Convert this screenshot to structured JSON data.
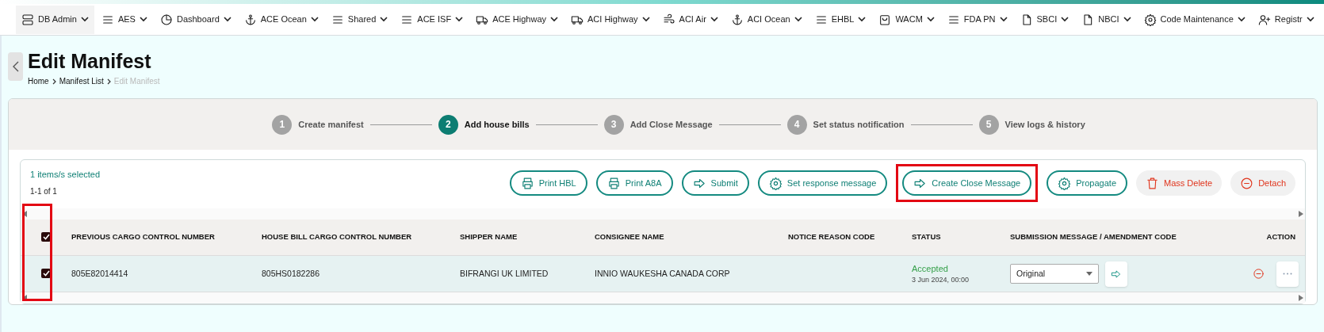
{
  "nav": [
    {
      "label": "DB Admin",
      "kind": "server",
      "selected": true
    },
    {
      "label": "AES",
      "kind": "menu",
      "selected": false
    },
    {
      "label": "Dashboard",
      "kind": "pie",
      "selected": false
    },
    {
      "label": "ACE Ocean",
      "kind": "anchor",
      "selected": false
    },
    {
      "label": "Shared",
      "kind": "menu",
      "selected": false
    },
    {
      "label": "ACE ISF",
      "kind": "menu",
      "selected": false
    },
    {
      "label": "ACE Highway",
      "kind": "truck",
      "selected": false
    },
    {
      "label": "ACI Highway",
      "kind": "truck",
      "selected": false
    },
    {
      "label": "ACI Air",
      "kind": "wind",
      "selected": false
    },
    {
      "label": "ACI Ocean",
      "kind": "anchor",
      "selected": false
    },
    {
      "label": "EHBL",
      "kind": "menu",
      "selected": false
    },
    {
      "label": "WACM",
      "kind": "bag",
      "selected": false
    },
    {
      "label": "FDA PN",
      "kind": "menu",
      "selected": false
    },
    {
      "label": "SBCI",
      "kind": "file",
      "selected": false
    },
    {
      "label": "NBCI",
      "kind": "file",
      "selected": false
    },
    {
      "label": "Code Maintenance",
      "kind": "gear",
      "selected": false
    },
    {
      "label": "Registr",
      "kind": "user",
      "selected": false
    }
  ],
  "page": {
    "title": "Edit Manifest",
    "breadcrumbs": [
      {
        "label": "Home",
        "current": false
      },
      {
        "label": "Manifest List",
        "current": false
      },
      {
        "label": "Edit Manifest",
        "current": true
      }
    ]
  },
  "steps": [
    {
      "number": "1",
      "label": "Create manifest",
      "selected": false
    },
    {
      "number": "2",
      "label": "Add house bills",
      "selected": true
    },
    {
      "number": "3",
      "label": "Add Close Message",
      "selected": false
    },
    {
      "number": "4",
      "label": "Set status notification",
      "selected": false
    },
    {
      "number": "5",
      "label": "View logs & history",
      "selected": false
    }
  ],
  "selection_summary": "1 items/s selected",
  "range": "1-1 of 1",
  "toolbar": [
    {
      "label": "Print HBL",
      "kind": "printer",
      "danger": false,
      "highlighted": false
    },
    {
      "label": "Print A8A",
      "kind": "printer",
      "danger": false,
      "highlighted": false
    },
    {
      "label": "Submit",
      "kind": "arrow",
      "danger": false,
      "highlighted": false
    },
    {
      "label": "Set response message",
      "kind": "gear",
      "danger": false,
      "highlighted": false
    },
    {
      "label": "Create Close Message",
      "kind": "arrow",
      "danger": false,
      "highlighted": true
    },
    {
      "label": "Propagate",
      "kind": "gear",
      "danger": false,
      "highlighted": false
    },
    {
      "label": "Mass Delete",
      "kind": "trash",
      "danger": true,
      "highlighted": false
    },
    {
      "label": "Detach",
      "kind": "minus",
      "danger": true,
      "highlighted": false
    }
  ],
  "table": {
    "select_all": true,
    "select_column_highlighted": true,
    "columns": [
      "PREVIOUS CARGO CONTROL NUMBER",
      "HOUSE BILL CARGO CONTROL NUMBER",
      "SHIPPER NAME",
      "CONSIGNEE NAME",
      "NOTICE REASON CODE",
      "STATUS",
      "SUBMISSION MESSAGE / AMENDMENT CODE",
      "ACTION"
    ],
    "rows": [
      {
        "checked": true,
        "previous_ccn": "805E82014414",
        "house_bill_ccn": "805HS0182286",
        "shipper": "BIFRANGI UK LIMITED",
        "consignee": "INNIO WAUKESHA CANADA CORP",
        "status": "Accepted",
        "status_date": "3 Jun 2024, 00:00",
        "submission_message": "Original"
      }
    ]
  }
}
